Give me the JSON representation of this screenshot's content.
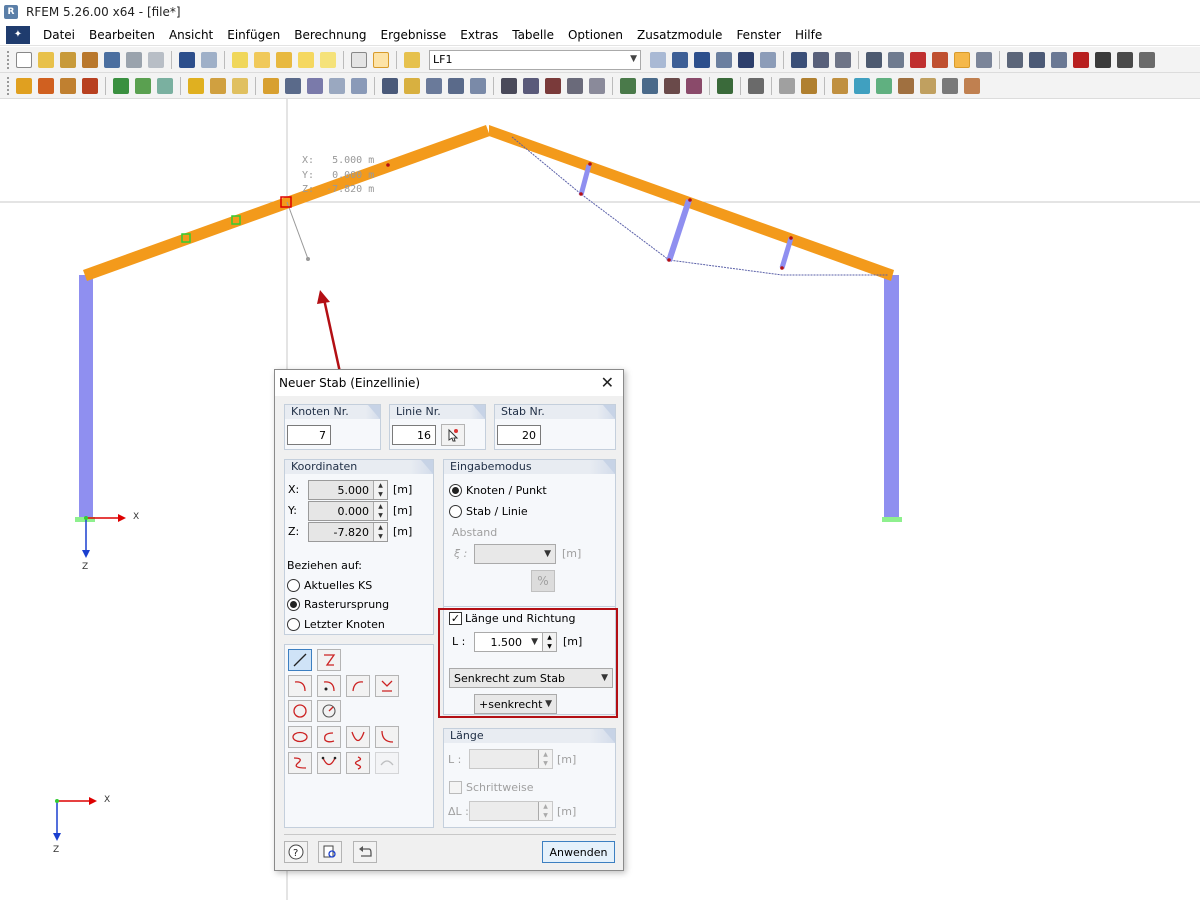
{
  "app": {
    "title": "RFEM 5.26.00 x64 - [file*]",
    "icon": "app-icon",
    "logo": "rfem-logo-icon"
  },
  "menu": {
    "items": [
      "Datei",
      "Bearbeiten",
      "Ansicht",
      "Einfügen",
      "Berechnung",
      "Ergebnisse",
      "Extras",
      "Tabelle",
      "Optionen",
      "Zusatzmodule",
      "Fenster",
      "Hilfe"
    ]
  },
  "toolbar": {
    "loadcase": "LF1"
  },
  "viewport": {
    "cursor_readout": {
      "x": "X:   5.000 m",
      "y": "Y:   0.000 m",
      "z": "Z:  -7.820 m"
    },
    "axes_main": {
      "x": "X",
      "z": "Z"
    },
    "axes_corner": {
      "x": "X",
      "z": "Z"
    },
    "colors": {
      "beam": "#f39a1b",
      "column": "#8f8ff0",
      "support": "#8ef08e",
      "arrow": "#b30f14"
    }
  },
  "dialog": {
    "title": "Neuer Stab (Einzellinie)",
    "knoten": {
      "label": "Knoten Nr.",
      "value": "7"
    },
    "linie": {
      "label": "Linie Nr.",
      "value": "16"
    },
    "stab": {
      "label": "Stab Nr.",
      "value": "20"
    },
    "koordinaten": {
      "label": "Koordinaten",
      "x": {
        "label": "X:",
        "value": "5.000",
        "unit": "[m]"
      },
      "y": {
        "label": "Y:",
        "value": "0.000",
        "unit": "[m]"
      },
      "z": {
        "label": "Z:",
        "value": "-7.820",
        "unit": "[m]"
      }
    },
    "beziehen": {
      "label": "Beziehen auf:",
      "options": [
        "Aktuelles KS",
        "Rasterursprung",
        "Letzter Knoten"
      ],
      "selected": "Rasterursprung"
    },
    "eingabemodus": {
      "label": "Eingabemodus",
      "mode1": "Knoten / Punkt",
      "mode2": "Stab / Linie",
      "abstand": "Abstand",
      "abstand_unit": "[m]",
      "percent": "%"
    },
    "laenge_richtung": {
      "label": "Länge und Richtung",
      "checked": true,
      "l_label": "L :",
      "l_value": "1.500",
      "unit": "[m]",
      "direction": "Senkrecht zum Stab",
      "sign": "+senkrecht"
    },
    "laenge": {
      "label": "Länge",
      "l_label": "L :",
      "unit": "[m]",
      "schritt": "Schrittweise",
      "dl_label": "ΔL :",
      "dl_unit": "[m]"
    },
    "buttons": {
      "apply": "Anwenden"
    }
  }
}
